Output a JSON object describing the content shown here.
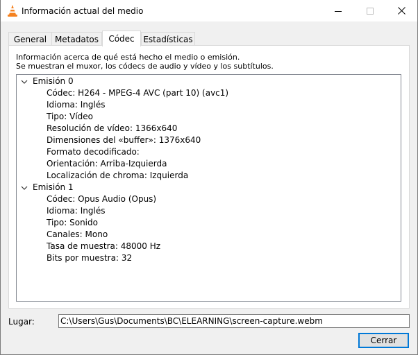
{
  "window": {
    "title": "Información actual del medio"
  },
  "tabs": [
    {
      "label": "General"
    },
    {
      "label": "Metadatos"
    },
    {
      "label": "Códec"
    },
    {
      "label": "Estadísticas"
    }
  ],
  "active_tab": "Códec",
  "description": {
    "line1": "Información acerca de qué está hecho el medio o emisión.",
    "line2": "Se muestran el muxor, los códecs de audio y vídeo y los subtítulos."
  },
  "streams": [
    {
      "label": "Emisión 0",
      "expanded": true,
      "items": [
        "Códec: H264 - MPEG-4 AVC (part 10) (avc1)",
        "Idioma: Inglés",
        "Tipo: Vídeo",
        "Resolución de vídeo: 1366x640",
        "Dimensiones del «buffer»: 1376x640",
        "Formato decodificado:",
        "Orientación: Arriba-Izquierda",
        "Localización de chroma: Izquierda"
      ]
    },
    {
      "label": "Emisión 1",
      "expanded": true,
      "items": [
        "Códec: Opus Audio (Opus)",
        "Idioma: Inglés",
        "Tipo: Sonido",
        "Canales: Mono",
        "Tasa de muestra: 48000 Hz",
        "Bits por muestra: 32"
      ]
    }
  ],
  "location": {
    "label": "Lugar:",
    "value": "C:\\Users\\Gus\\Documents\\BC\\ELEARNING\\screen-capture.webm"
  },
  "buttons": {
    "close_label": "Cerrar"
  },
  "colors": {
    "accent": "#0078d7",
    "vlc_orange": "#f58220"
  },
  "icons": {
    "app": "vlc-cone-icon",
    "minimize": "minimize-icon",
    "maximize": "maximize-icon",
    "close": "close-icon",
    "expand": "chevron-down-icon"
  }
}
